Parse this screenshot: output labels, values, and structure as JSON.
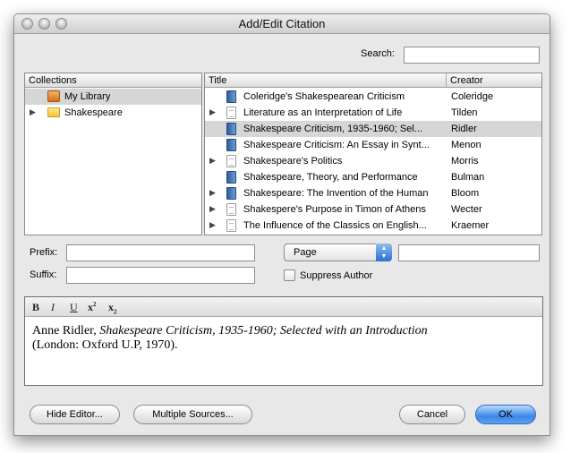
{
  "window": {
    "title": "Add/Edit Citation"
  },
  "search": {
    "label": "Search:",
    "value": ""
  },
  "collections": {
    "header": "Collections",
    "items": [
      {
        "label": "My Library",
        "icon": "library-icon",
        "selected": true
      },
      {
        "label": "Shakespeare",
        "icon": "folder-icon",
        "selected": false
      }
    ]
  },
  "items_table": {
    "columns": [
      "Title",
      "Creator"
    ],
    "rows": [
      {
        "title": "Coleridge's Shakespearean Criticism",
        "creator": "Coleridge",
        "icon": "book-icon"
      },
      {
        "title": "Literature as an Interpretation of Life",
        "creator": "Tilden",
        "icon": "document-icon"
      },
      {
        "title": "Shakespeare Criticism, 1935-1960; Sel...",
        "creator": "Ridler",
        "icon": "book-icon"
      },
      {
        "title": "Shakespeare Criticism: An Essay in Synt...",
        "creator": "Menon",
        "icon": "book-icon"
      },
      {
        "title": "Shakespeare's Politics",
        "creator": "Morris",
        "icon": "document-icon"
      },
      {
        "title": "Shakespeare, Theory, and Performance",
        "creator": "Bulman",
        "icon": "book-icon"
      },
      {
        "title": "Shakespeare: The Invention of the Human",
        "creator": "Bloom",
        "icon": "book-icon"
      },
      {
        "title": "Shakespere's Purpose in Timon of Athens",
        "creator": "Wecter",
        "icon": "document-icon"
      },
      {
        "title": "The Influence of the Classics on English...",
        "creator": "Kraemer",
        "icon": "document-icon"
      }
    ]
  },
  "locator": {
    "prefix_label": "Prefix:",
    "suffix_label": "Suffix:",
    "prefix_value": "",
    "suffix_value": "",
    "locator_type": "Page",
    "locator_value": "",
    "suppress_author_label": "Suppress Author"
  },
  "editor": {
    "toolbar": {
      "bold": "B",
      "italic": "I",
      "underline": "U",
      "superscript": "x",
      "subscript": "x",
      "sup_mark": "2",
      "sub_mark": "2"
    },
    "text_prefix": "Anne Ridler, ",
    "text_italic": "Shakespeare Criticism, 1935-1960; Selected with an Introduction",
    "text_suffix": "(London: Oxford U.P, 1970)."
  },
  "buttons": {
    "hide_editor": "Hide Editor...",
    "multiple_sources": "Multiple Sources...",
    "cancel": "Cancel",
    "ok": "OK"
  }
}
